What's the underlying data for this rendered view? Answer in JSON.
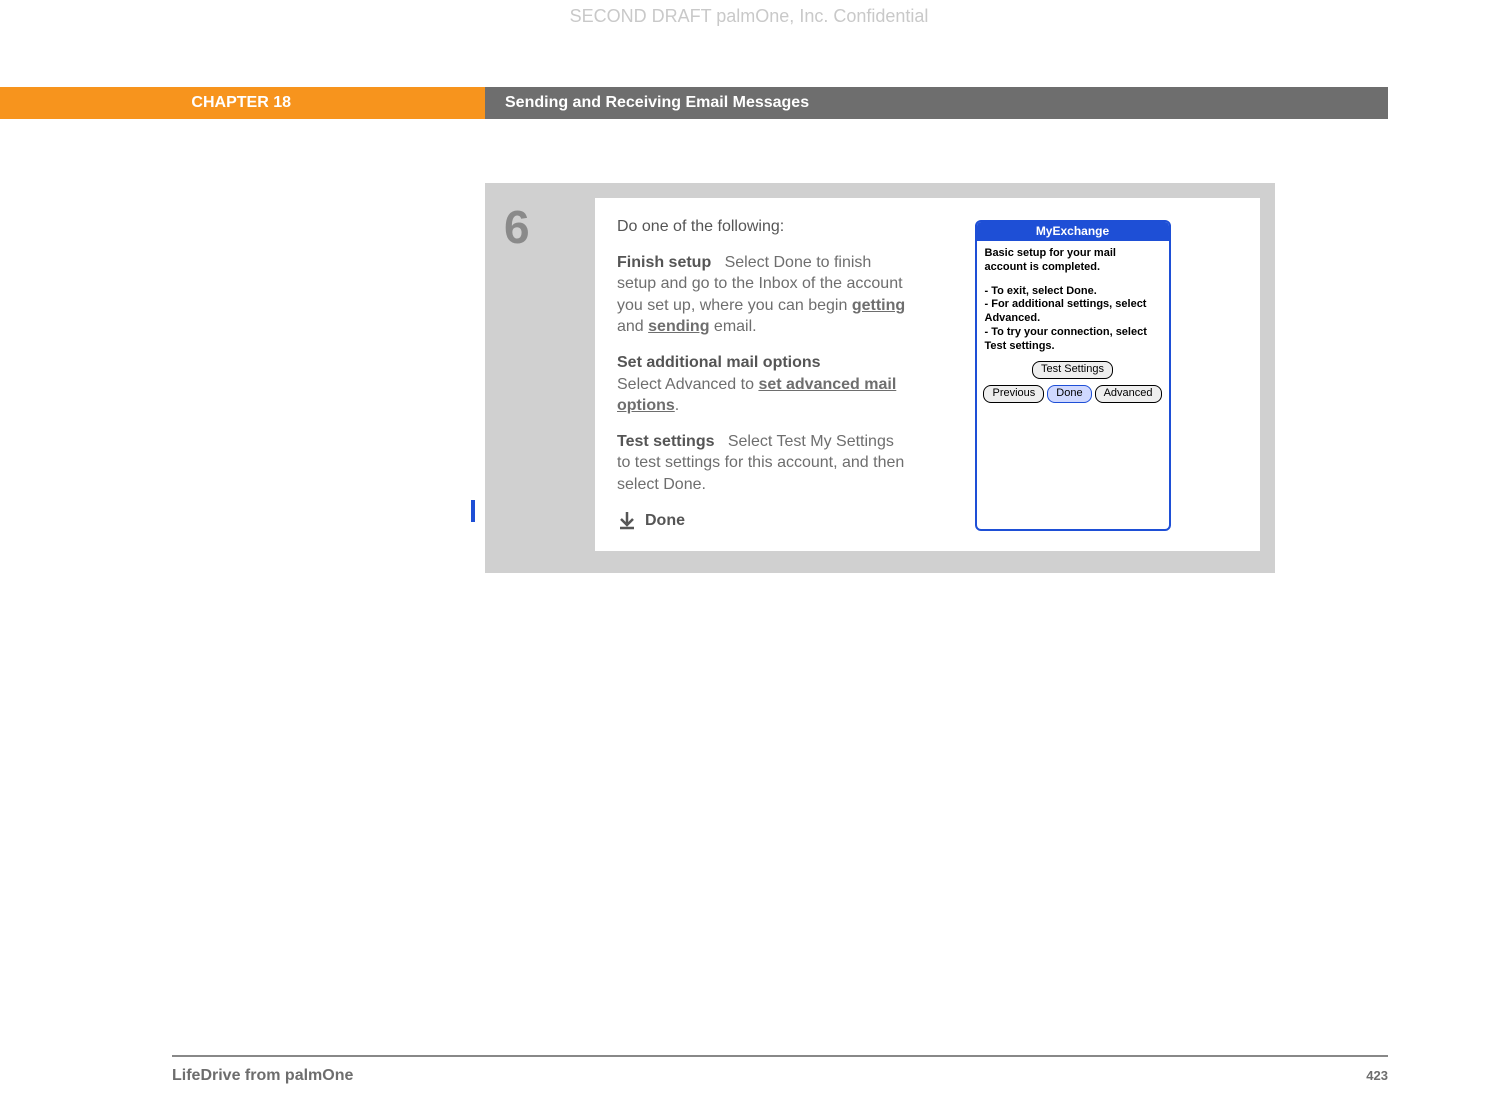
{
  "watermark": "SECOND DRAFT palmOne, Inc.  Confidential",
  "chapter": {
    "label": "CHAPTER 18",
    "title": "Sending and Receiving Email Messages"
  },
  "step": {
    "number": "6",
    "intro": "Do one of the following:",
    "finish": {
      "label": "Finish setup",
      "before_link1": "Select Done to finish setup and go to the Inbox of the account you set up, where you can begin ",
      "link1": "getting",
      "between": " and ",
      "link2": "sending",
      "after": " email."
    },
    "addl": {
      "label": "Set additional mail options",
      "before_link": "Select Advanced to ",
      "link": "set advanced mail options",
      "after": "."
    },
    "test": {
      "label": "Test settings",
      "text": "Select Test My Settings to test settings for this account, and then select Done."
    },
    "done_label": "Done"
  },
  "palm": {
    "title": "MyExchange",
    "line1": "Basic setup for your mail account is completed.",
    "bullet1": "- To exit, select Done.",
    "bullet2": "- For additional settings, select Advanced.",
    "bullet3": "- To try your connection, select Test settings.",
    "btn_test": "Test Settings",
    "btn_prev": "Previous",
    "btn_done": "Done",
    "btn_adv": "Advanced"
  },
  "footer": {
    "product": "LifeDrive from palmOne",
    "page": "423"
  }
}
